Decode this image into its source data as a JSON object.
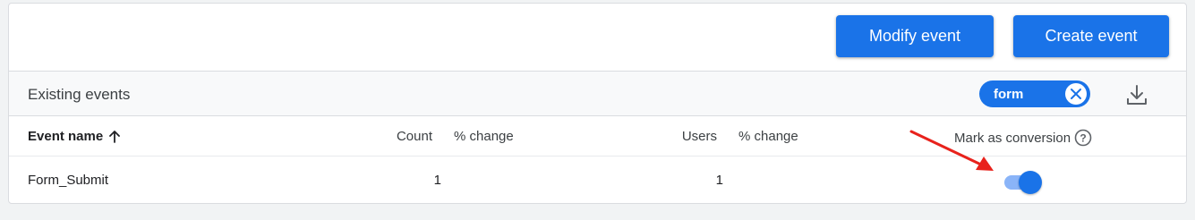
{
  "toolbar": {
    "modify_label": "Modify event",
    "create_label": "Create event"
  },
  "section": {
    "title": "Existing events",
    "filter_chip": "form"
  },
  "table": {
    "columns": {
      "event_name": "Event name",
      "count": "Count",
      "pct_change_count": "% change",
      "users": "Users",
      "pct_change_users": "% change",
      "mark_conversion": "Mark as conversion"
    },
    "rows": [
      {
        "event_name": "Form_Submit",
        "count": "1",
        "users": "1",
        "conversion_on": true
      }
    ]
  },
  "colors": {
    "accent": "#1a73e8",
    "toggle_track": "#8ab4f8",
    "annotation_arrow": "#e8221c"
  }
}
